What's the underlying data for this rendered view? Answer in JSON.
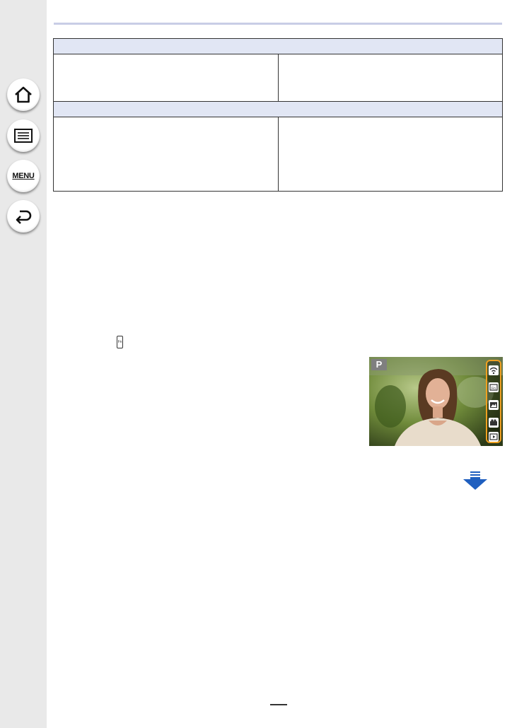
{
  "sidebar": {
    "items": [
      {
        "icon": "home-icon"
      },
      {
        "icon": "contents-list-icon"
      },
      {
        "icon": "menu-icon",
        "label": "MENU"
      },
      {
        "icon": "back-icon"
      }
    ]
  },
  "table": {
    "sections": [
      {
        "header": "",
        "cells": [
          "",
          ""
        ]
      },
      {
        "header": "",
        "cells": [
          "",
          ""
        ]
      }
    ]
  },
  "fn_button_icon": {
    "icon": "fn-button-icon"
  },
  "screen_image": {
    "mode": "P",
    "touch_tabs": [
      "wifi-icon",
      "fn-tab-icon",
      "scene-icon",
      "movie-icon",
      "playback-icon"
    ],
    "highlight_color": "#f0a020"
  },
  "nav": {
    "next_page_icon": "next-page-arrow-icon",
    "arrow_color": "#1f5fbf"
  }
}
